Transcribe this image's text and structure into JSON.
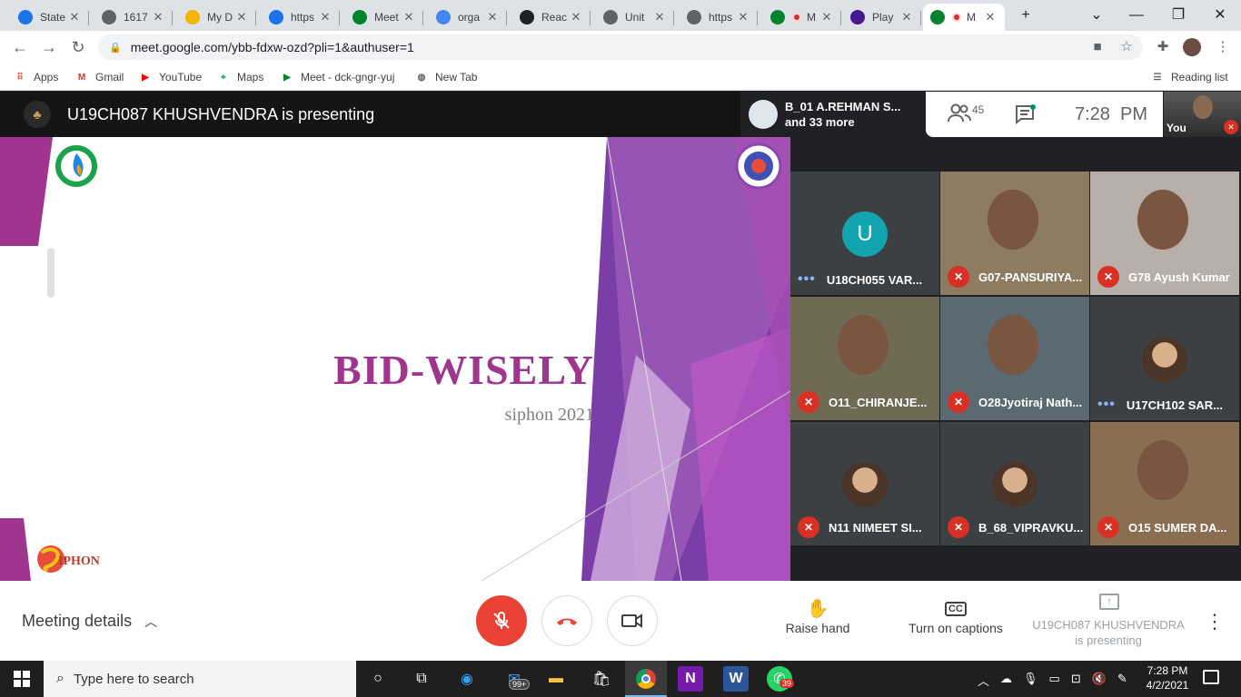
{
  "browser": {
    "tabs": [
      {
        "title": "State",
        "icon": "info-icon",
        "color": "#1a73e8"
      },
      {
        "title": "1617",
        "icon": "globe-icon",
        "color": "#5f6368"
      },
      {
        "title": "My D",
        "icon": "drive-icon",
        "color": "#f4b400"
      },
      {
        "title": "https",
        "icon": "filter-icon",
        "color": "#1a73e8"
      },
      {
        "title": "Meet",
        "icon": "meet-icon",
        "color": "#00832d"
      },
      {
        "title": "orga",
        "icon": "google-icon",
        "color": "#4285f4"
      },
      {
        "title": "Reac",
        "icon": "bts-icon",
        "color": "#202124"
      },
      {
        "title": "Unit",
        "icon": "unit-icon",
        "color": "#5f6368"
      },
      {
        "title": "https",
        "icon": "globe-icon",
        "color": "#5f6368"
      },
      {
        "title": "M",
        "icon": "meet-icon",
        "color": "#00832d",
        "recording": true
      },
      {
        "title": "Play",
        "icon": "kahoot-icon",
        "color": "#46178f"
      },
      {
        "title": "M",
        "icon": "meet-icon",
        "color": "#00832d",
        "recording": true,
        "active": true
      }
    ],
    "new_tab_label": "+",
    "url": "meet.google.com/ybb-fdxw-ozd?pli=1&authuser=1",
    "bookmarks": [
      {
        "label": "Apps",
        "icon": "apps-grid-icon"
      },
      {
        "label": "Gmail",
        "icon": "gmail-icon"
      },
      {
        "label": "YouTube",
        "icon": "youtube-icon"
      },
      {
        "label": "Maps",
        "icon": "maps-icon"
      },
      {
        "label": "Meet - dck-gngr-yuj",
        "icon": "meet-icon"
      },
      {
        "label": "New Tab",
        "icon": "globe-icon"
      }
    ],
    "reading_list": "Reading list"
  },
  "meet": {
    "presenter_banner": "U19CH087 KHUSHVENDRA is presenting",
    "people_chip": {
      "line1": "B_01 A.REHMAN S...",
      "line2": "and 33 more"
    },
    "participant_count": "45",
    "time": "7:28  PM",
    "self_label": "You",
    "slide": {
      "title": "BID-WISELY",
      "subtitle": "siphon 2021",
      "logo_text": "IPHON"
    },
    "tiles": [
      {
        "name": "U18CH055 VAR...",
        "status": "speaking",
        "avatar_letter": "U",
        "kind": "letter",
        "avatar_color": "#12a4af"
      },
      {
        "name": "G07-PANSURIYA...",
        "status": "muted",
        "kind": "video"
      },
      {
        "name": "G78 Ayush Kumar",
        "status": "muted",
        "kind": "video"
      },
      {
        "name": "O11_CHIRANJE...",
        "status": "muted",
        "kind": "video"
      },
      {
        "name": "O28Jyotiraj Nath...",
        "status": "muted",
        "kind": "video"
      },
      {
        "name": "U17CH102 SAR...",
        "status": "speaking",
        "kind": "photo"
      },
      {
        "name": "N11 NIMEET SI...",
        "status": "muted",
        "kind": "photo"
      },
      {
        "name": "B_68_VIPRAVKU...",
        "status": "muted",
        "kind": "photo"
      },
      {
        "name": "O15 SUMER DA...",
        "status": "muted",
        "kind": "video"
      }
    ],
    "bottom": {
      "meeting_details": "Meeting details",
      "raise_hand": "Raise hand",
      "captions": "Turn on captions",
      "presenting_line1": "U19CH087 KHUSHVENDRA",
      "presenting_line2": "is presenting"
    }
  },
  "taskbar": {
    "search_placeholder": "Type here to search",
    "mail_badge": "99+",
    "whatsapp_badge": "39",
    "time": "7:28 PM",
    "date": "4/2/2021"
  }
}
